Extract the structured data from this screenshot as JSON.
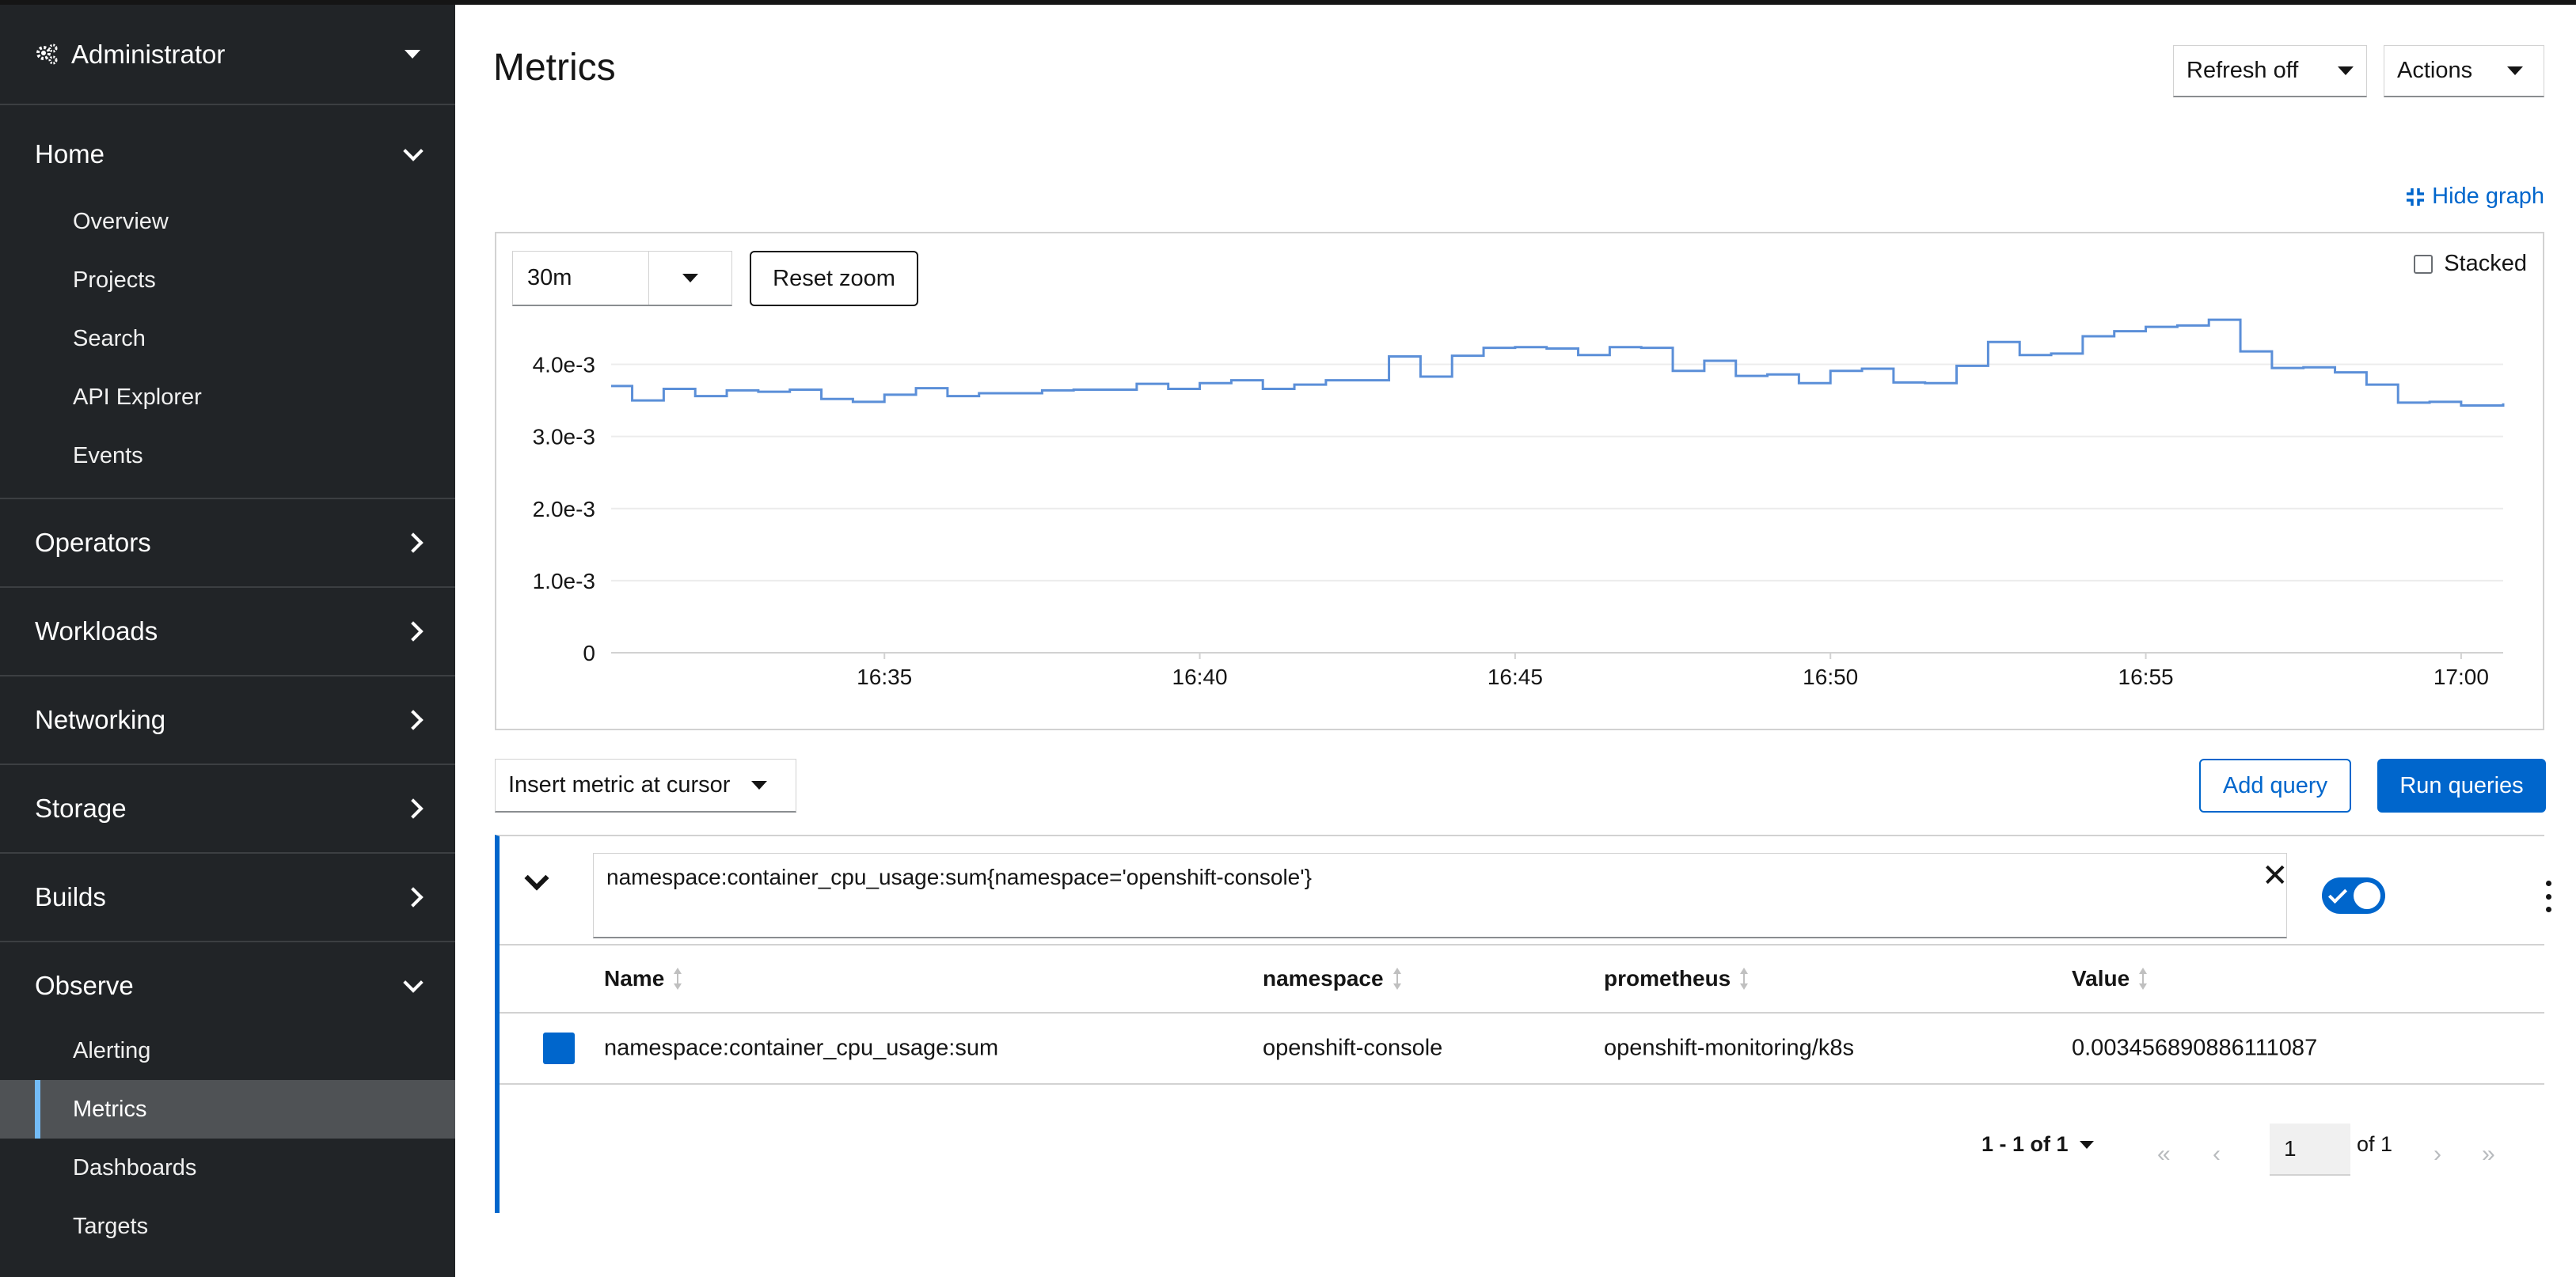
{
  "sidebar": {
    "perspective": "Administrator",
    "sections": [
      {
        "label": "Home",
        "expanded": true,
        "items": [
          "Overview",
          "Projects",
          "Search",
          "API Explorer",
          "Events"
        ]
      },
      {
        "label": "Operators",
        "expanded": false
      },
      {
        "label": "Workloads",
        "expanded": false
      },
      {
        "label": "Networking",
        "expanded": false
      },
      {
        "label": "Storage",
        "expanded": false
      },
      {
        "label": "Builds",
        "expanded": false
      },
      {
        "label": "Observe",
        "expanded": true,
        "items": [
          "Alerting",
          "Metrics",
          "Dashboards",
          "Targets"
        ],
        "active": "Metrics"
      }
    ]
  },
  "header": {
    "title": "Metrics",
    "refresh": "Refresh off",
    "actions": "Actions"
  },
  "graph": {
    "hide_label": "Hide graph",
    "range": "30m",
    "reset_zoom": "Reset zoom",
    "stacked_label": "Stacked",
    "stacked_checked": false
  },
  "chart_data": {
    "type": "line",
    "title": "",
    "xlabel": "",
    "ylabel": "",
    "y_ticks": [
      "4.0e-3",
      "3.0e-3",
      "2.0e-3",
      "1.0e-3",
      "0"
    ],
    "x_ticks": [
      "16:35",
      "16:40",
      "16:45",
      "16:50",
      "16:55",
      "17:00"
    ],
    "ylim": [
      0,
      0.0045
    ],
    "xlim": [
      "16:30:40",
      "17:00:40"
    ],
    "series": [
      {
        "color": "#5b8fd8",
        "x": [
          "16:30:40",
          "16:31:00",
          "16:31:30",
          "16:32:00",
          "16:32:30",
          "16:33:00",
          "16:33:30",
          "16:34:00",
          "16:34:30",
          "16:35:00",
          "16:35:30",
          "16:36:00",
          "16:36:30",
          "16:37:00",
          "16:37:30",
          "16:38:00",
          "16:38:30",
          "16:39:00",
          "16:39:30",
          "16:40:00",
          "16:40:30",
          "16:41:00",
          "16:41:30",
          "16:42:00",
          "16:42:30",
          "16:43:00",
          "16:43:30",
          "16:44:00",
          "16:44:30",
          "16:45:00",
          "16:45:30",
          "16:46:00",
          "16:46:30",
          "16:47:00",
          "16:47:30",
          "16:48:00",
          "16:48:30",
          "16:49:00",
          "16:49:30",
          "16:50:00",
          "16:50:30",
          "16:51:00",
          "16:51:30",
          "16:52:00",
          "16:52:30",
          "16:53:00",
          "16:53:30",
          "16:54:00",
          "16:54:30",
          "16:55:00",
          "16:55:30",
          "16:56:00",
          "16:56:30",
          "16:57:00",
          "16:57:30",
          "16:58:00",
          "16:58:30",
          "16:59:00",
          "16:59:30",
          "17:00:00",
          "17:00:40"
        ],
        "values": [
          0.0037,
          0.0035,
          0.00366,
          0.00356,
          0.00364,
          0.00362,
          0.00365,
          0.00352,
          0.00348,
          0.00358,
          0.00367,
          0.00356,
          0.0036,
          0.0036,
          0.00364,
          0.00365,
          0.00365,
          0.00373,
          0.00366,
          0.00374,
          0.00378,
          0.00366,
          0.00372,
          0.00378,
          0.00378,
          0.00411,
          0.00383,
          0.00412,
          0.00423,
          0.00424,
          0.00422,
          0.00413,
          0.00424,
          0.00423,
          0.00391,
          0.00405,
          0.00384,
          0.00386,
          0.00374,
          0.00391,
          0.00394,
          0.00375,
          0.00374,
          0.00398,
          0.00431,
          0.00413,
          0.00415,
          0.00439,
          0.00446,
          0.00452,
          0.00454,
          0.00462,
          0.00418,
          0.00395,
          0.00396,
          0.00389,
          0.00372,
          0.00347,
          0.00348,
          0.00343,
          0.00346
        ]
      }
    ]
  },
  "query_toolbar": {
    "insert_metric": "Insert metric at cursor",
    "add_query": "Add query",
    "run_queries": "Run queries"
  },
  "query": {
    "expression": "namespace:container_cpu_usage:sum{namespace='openshift-console'}",
    "enabled": true,
    "columns": [
      "Name",
      "namespace",
      "prometheus",
      "Value"
    ],
    "rows": [
      {
        "color": "#0066cc",
        "cells": [
          "namespace:container_cpu_usage:sum",
          "openshift-console",
          "openshift-monitoring/k8s",
          "0.003456890886111087"
        ]
      }
    ]
  },
  "pagination": {
    "range": "1 - 1 of 1",
    "page": "1",
    "of_pages": "of 1"
  }
}
